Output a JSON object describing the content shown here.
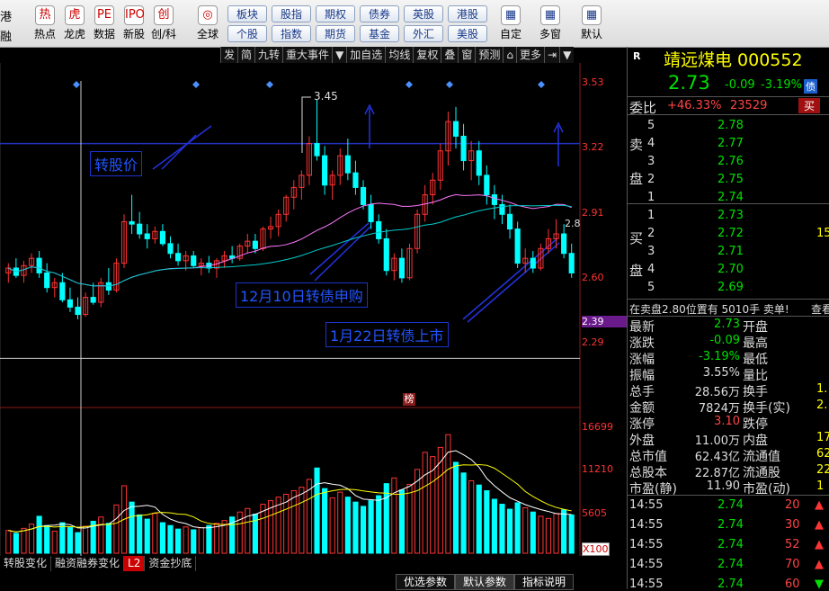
{
  "toolbar": {
    "left_top": "港",
    "left_bottom": "融",
    "icons": [
      {
        "label": "热点",
        "icon": "hotspot-icon",
        "glyph": "热"
      },
      {
        "label": "龙虎",
        "icon": "dragon-tiger-icon",
        "glyph": "虎"
      },
      {
        "label": "数据",
        "icon": "data-icon",
        "glyph": "PE"
      },
      {
        "label": "新股",
        "icon": "ipo-icon",
        "glyph": "IPO"
      },
      {
        "label": "创/科",
        "icon": "chuangke-icon",
        "glyph": "创"
      },
      {
        "label": "全球",
        "icon": "globe-icon",
        "glyph": "◎"
      }
    ],
    "market_buttons_top": [
      "板块",
      "股指",
      "期权",
      "债券",
      "英股",
      "港股"
    ],
    "market_buttons_bottom": [
      "个股",
      "指数",
      "期货",
      "基金",
      "外汇",
      "美股"
    ],
    "right_items": [
      {
        "label": "自定",
        "icon": "custom-icon"
      },
      {
        "label": "多窗",
        "icon": "multi-window-icon"
      },
      {
        "label": "默认",
        "icon": "home-icon"
      }
    ]
  },
  "chart_toolbar": [
    "发",
    "简",
    "九转",
    "重大事件",
    "▼",
    "加自选",
    "均线",
    "复权",
    "叠",
    "窗",
    "预测",
    "⌂",
    "更多",
    "⇥",
    "▼"
  ],
  "price_axis": [
    "3.53",
    "3.22",
    "2.91",
    "2.60",
    "2.39",
    "2.29"
  ],
  "last_price_marker": "2.8",
  "volume_axis": [
    "16699",
    "11210",
    "5605",
    "X100"
  ],
  "annotations": {
    "a1": "转股价",
    "a2": "12月10日转债申购",
    "a3": "1月22日转债上市",
    "peak_label": "3.45",
    "bang": "榜"
  },
  "bottom_tabs": [
    "转股变化",
    "融资融券变化",
    "L2",
    "资金抄底"
  ],
  "bottom_right_tabs": [
    "优选参数",
    "默认参数",
    "指标说明"
  ],
  "quote": {
    "r_mark": "R",
    "name": "靖远煤电 000552",
    "price": "2.73",
    "change": "-0.09",
    "pct": "-3.19%",
    "debt_tag": "债",
    "weibi_label": "委比",
    "weibi": "+46.33%",
    "weicha": "23529",
    "buy_btn": "买",
    "sell_side_label": [
      "卖",
      "盘"
    ],
    "buy_side_label": [
      "买",
      "盘"
    ],
    "asks": [
      {
        "lvl": "5",
        "price": "2.78",
        "vol": ""
      },
      {
        "lvl": "4",
        "price": "2.77",
        "vol": ""
      },
      {
        "lvl": "3",
        "price": "2.76",
        "vol": ""
      },
      {
        "lvl": "2",
        "price": "2.75",
        "vol": ""
      },
      {
        "lvl": "1",
        "price": "2.74",
        "vol": ""
      }
    ],
    "bids": [
      {
        "lvl": "1",
        "price": "2.73",
        "vol": ""
      },
      {
        "lvl": "2",
        "price": "2.72",
        "vol": "15"
      },
      {
        "lvl": "3",
        "price": "2.71",
        "vol": ""
      },
      {
        "lvl": "4",
        "price": "2.70",
        "vol": ""
      },
      {
        "lvl": "5",
        "price": "2.69",
        "vol": ""
      }
    ],
    "position_text": "在卖盘2.80位置有 5010手 卖单!",
    "view_link": "查看",
    "stats": [
      {
        "l": "最新",
        "v": "2.73",
        "l2": "开盘",
        "v2": ""
      },
      {
        "l": "涨跌",
        "v": "-0.09",
        "l2": "最高",
        "v2": ""
      },
      {
        "l": "涨幅",
        "v": "-3.19%",
        "l2": "最低",
        "v2": ""
      },
      {
        "l": "振幅",
        "v": "3.55%",
        "l2": "量比",
        "v2": ""
      },
      {
        "l": "总手",
        "v": "28.56万",
        "l2": "换手",
        "v2": "1."
      },
      {
        "l": "金额",
        "v": "7824万",
        "l2": "换手(实)",
        "v2": "2."
      },
      {
        "l": "涨停",
        "v": "3.10",
        "l2": "跌停",
        "v2": ""
      },
      {
        "l": "外盘",
        "v": "11.00万",
        "l2": "内盘",
        "v2": "17.5"
      },
      {
        "l": "总市值",
        "v": "62.43亿",
        "l2": "流通值",
        "v2": "62.3"
      },
      {
        "l": "总股本",
        "v": "22.87亿",
        "l2": "流通股",
        "v2": "22.8"
      },
      {
        "l": "市盈(静)",
        "v": "11.90",
        "l2": "市盈(动)",
        "v2": "1"
      }
    ],
    "ticks": [
      {
        "t": "14:55",
        "p": "2.74",
        "v": "20",
        "dir": "up"
      },
      {
        "t": "14:55",
        "p": "2.74",
        "v": "30",
        "dir": "up"
      },
      {
        "t": "14:55",
        "p": "2.74",
        "v": "52",
        "dir": "up"
      },
      {
        "t": "14:55",
        "p": "2.74",
        "v": "70",
        "dir": "up"
      },
      {
        "t": "14:55",
        "p": "2.74",
        "v": "60",
        "dir": "down"
      }
    ]
  },
  "colors": {
    "up": "#ff3333",
    "down": "#00ffff",
    "ma5": "#ffffff",
    "ma10": "#ffff00",
    "ma20": "#ff77ff",
    "ma60": "#00cccc"
  },
  "chart_data": {
    "type": "candlestick",
    "price_ylim": [
      2.2,
      3.6
    ],
    "volume_ylim": [
      0,
      19000
    ],
    "candles": [
      [
        2.74,
        2.78,
        2.7,
        2.76
      ],
      [
        2.76,
        2.8,
        2.72,
        2.73
      ],
      [
        2.73,
        2.79,
        2.7,
        2.77
      ],
      [
        2.77,
        2.82,
        2.74,
        2.8
      ],
      [
        2.8,
        2.83,
        2.72,
        2.74
      ],
      [
        2.74,
        2.78,
        2.66,
        2.68
      ],
      [
        2.68,
        2.72,
        2.64,
        2.7
      ],
      [
        2.7,
        2.74,
        2.62,
        2.63
      ],
      [
        2.63,
        2.68,
        2.58,
        2.6
      ],
      [
        2.6,
        2.64,
        2.55,
        2.57
      ],
      [
        2.57,
        2.66,
        2.56,
        2.64
      ],
      [
        2.64,
        2.7,
        2.61,
        2.62
      ],
      [
        2.62,
        2.72,
        2.6,
        2.7
      ],
      [
        2.7,
        2.76,
        2.65,
        2.67
      ],
      [
        2.67,
        2.8,
        2.66,
        2.78
      ],
      [
        2.78,
        2.98,
        2.76,
        2.95
      ],
      [
        2.95,
        3.06,
        2.9,
        2.94
      ],
      [
        2.94,
        2.99,
        2.88,
        2.9
      ],
      [
        2.9,
        2.94,
        2.84,
        2.88
      ],
      [
        2.88,
        2.93,
        2.86,
        2.91
      ],
      [
        2.91,
        2.94,
        2.85,
        2.86
      ],
      [
        2.86,
        2.89,
        2.8,
        2.82
      ],
      [
        2.82,
        2.86,
        2.77,
        2.79
      ],
      [
        2.79,
        2.83,
        2.75,
        2.81
      ],
      [
        2.81,
        2.83,
        2.76,
        2.77
      ],
      [
        2.77,
        2.8,
        2.73,
        2.78
      ],
      [
        2.78,
        2.81,
        2.74,
        2.76
      ],
      [
        2.76,
        2.8,
        2.72,
        2.79
      ],
      [
        2.79,
        2.83,
        2.76,
        2.81
      ],
      [
        2.81,
        2.85,
        2.78,
        2.8
      ],
      [
        2.8,
        2.86,
        2.79,
        2.85
      ],
      [
        2.85,
        2.9,
        2.82,
        2.87
      ],
      [
        2.87,
        2.9,
        2.82,
        2.84
      ],
      [
        2.84,
        2.93,
        2.83,
        2.92
      ],
      [
        2.92,
        2.97,
        2.88,
        2.93
      ],
      [
        2.93,
        3.0,
        2.89,
        2.98
      ],
      [
        2.98,
        3.06,
        2.95,
        3.05
      ],
      [
        3.05,
        3.12,
        3.0,
        3.09
      ],
      [
        3.09,
        3.16,
        3.04,
        3.14
      ],
      [
        3.14,
        3.3,
        3.1,
        3.27
      ],
      [
        3.27,
        3.45,
        3.2,
        3.22
      ],
      [
        3.22,
        3.26,
        3.06,
        3.1
      ],
      [
        3.1,
        3.16,
        3.04,
        3.14
      ],
      [
        3.14,
        3.25,
        3.1,
        3.22
      ],
      [
        3.22,
        3.29,
        3.12,
        3.15
      ],
      [
        3.15,
        3.2,
        3.06,
        3.09
      ],
      [
        3.09,
        3.12,
        3.0,
        3.02
      ],
      [
        3.02,
        3.06,
        2.92,
        2.95
      ],
      [
        2.95,
        2.98,
        2.86,
        2.88
      ],
      [
        2.88,
        2.92,
        2.73,
        2.75
      ],
      [
        2.75,
        2.82,
        2.71,
        2.8
      ],
      [
        2.8,
        2.84,
        2.7,
        2.72
      ],
      [
        2.72,
        2.86,
        2.71,
        2.84
      ],
      [
        2.84,
        3.0,
        2.82,
        2.98
      ],
      [
        2.98,
        3.1,
        2.95,
        3.06
      ],
      [
        3.06,
        3.15,
        3.02,
        3.12
      ],
      [
        3.12,
        3.27,
        3.08,
        3.24
      ],
      [
        3.24,
        3.4,
        3.18,
        3.36
      ],
      [
        3.36,
        3.42,
        3.25,
        3.3
      ],
      [
        3.3,
        3.35,
        3.16,
        3.2
      ],
      [
        3.2,
        3.28,
        3.12,
        3.24
      ],
      [
        3.24,
        3.28,
        3.1,
        3.14
      ],
      [
        3.14,
        3.18,
        3.02,
        3.06
      ],
      [
        3.06,
        3.1,
        2.96,
        3.02
      ],
      [
        3.02,
        3.06,
        2.94,
        2.98
      ],
      [
        2.98,
        3.02,
        2.88,
        2.92
      ],
      [
        2.92,
        2.95,
        2.76,
        2.78
      ],
      [
        2.78,
        2.84,
        2.74,
        2.8
      ],
      [
        2.8,
        2.83,
        2.74,
        2.76
      ],
      [
        2.76,
        2.86,
        2.75,
        2.84
      ],
      [
        2.84,
        2.92,
        2.82,
        2.88
      ],
      [
        2.88,
        2.96,
        2.84,
        2.9
      ],
      [
        2.9,
        2.94,
        2.8,
        2.82
      ],
      [
        2.82,
        2.86,
        2.72,
        2.74
      ]
    ],
    "volume": [
      3200,
      2800,
      3500,
      4100,
      5200,
      3900,
      3100,
      4300,
      3600,
      2900,
      3800,
      4500,
      5100,
      4200,
      6800,
      9500,
      7200,
      5400,
      4800,
      5600,
      4300,
      3900,
      3400,
      3700,
      3300,
      3600,
      3900,
      4200,
      4600,
      5100,
      5800,
      6300,
      5500,
      6900,
      7400,
      7900,
      8300,
      8800,
      9300,
      10400,
      12000,
      9100,
      7800,
      8600,
      7900,
      7200,
      6600,
      7400,
      8100,
      9800,
      10600,
      8900,
      9700,
      11800,
      14200,
      13600,
      14900,
      16699,
      12800,
      11300,
      10200,
      9600,
      8800,
      7600,
      6900,
      6200,
      7100,
      6400,
      5800,
      5200,
      4900,
      5600,
      6100,
      5400
    ],
    "vol_colors_up": true
  }
}
